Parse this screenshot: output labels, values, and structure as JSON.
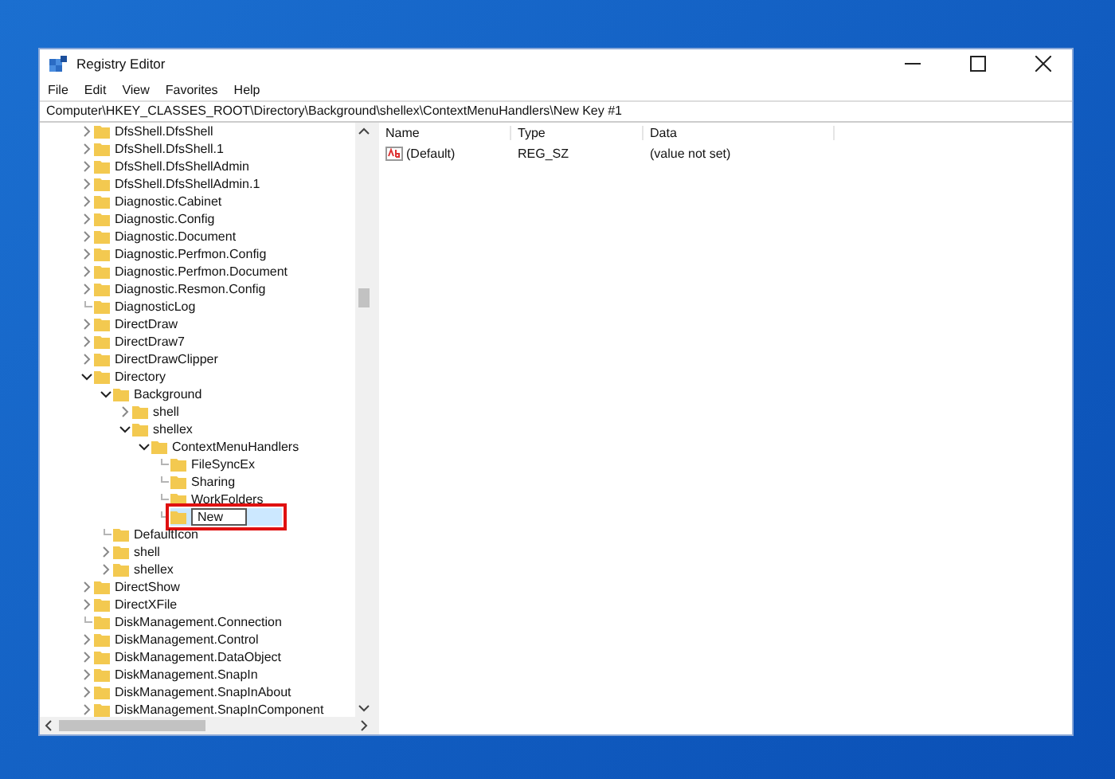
{
  "window": {
    "title": "Registry Editor"
  },
  "menu": [
    "File",
    "Edit",
    "View",
    "Favorites",
    "Help"
  ],
  "address": "Computer\\HKEY_CLASSES_ROOT\\Directory\\Background\\shellex\\ContextMenuHandlers\\New Key #1",
  "tree": [
    {
      "label": "DfsShell.DfsShell",
      "expandable": true,
      "expanded": false,
      "selected": false
    },
    {
      "label": "DfsShell.DfsShell.1",
      "expandable": true,
      "expanded": false,
      "selected": false
    },
    {
      "label": "DfsShell.DfsShellAdmin",
      "expandable": true,
      "expanded": false,
      "selected": false
    },
    {
      "label": "DfsShell.DfsShellAdmin.1",
      "expandable": true,
      "expanded": false,
      "selected": false
    },
    {
      "label": "Diagnostic.Cabinet",
      "expandable": true,
      "expanded": false,
      "selected": false
    },
    {
      "label": "Diagnostic.Config",
      "expandable": true,
      "expanded": false,
      "selected": false
    },
    {
      "label": "Diagnostic.Document",
      "expandable": true,
      "expanded": false,
      "selected": false
    },
    {
      "label": "Diagnostic.Perfmon.Config",
      "expandable": true,
      "expanded": false,
      "selected": false
    },
    {
      "label": "Diagnostic.Perfmon.Document",
      "expandable": true,
      "expanded": false,
      "selected": false
    },
    {
      "label": "Diagnostic.Resmon.Config",
      "expandable": true,
      "expanded": false,
      "selected": false
    },
    {
      "label": "DiagnosticLog",
      "expandable": false,
      "selected": false
    },
    {
      "label": "DirectDraw",
      "expandable": true,
      "expanded": false,
      "selected": false
    },
    {
      "label": "DirectDraw7",
      "expandable": true,
      "expanded": false,
      "selected": false
    },
    {
      "label": "DirectDrawClipper",
      "expandable": true,
      "expanded": false,
      "selected": false
    },
    {
      "label": "Directory",
      "expandable": true,
      "expanded": true,
      "selected": false,
      "children": [
        {
          "label": "Background",
          "expandable": true,
          "expanded": true,
          "selected": false,
          "children": [
            {
              "label": "shell",
              "expandable": true,
              "expanded": false,
              "selected": false
            },
            {
              "label": "shellex",
              "expandable": true,
              "expanded": true,
              "selected": false,
              "children": [
                {
                  "label": "ContextMenuHandlers",
                  "expandable": true,
                  "expanded": true,
                  "selected": false,
                  "children": [
                    {
                      "label": "FileSyncEx",
                      "expandable": false,
                      "selected": false
                    },
                    {
                      "label": "Sharing",
                      "expandable": false,
                      "selected": false
                    },
                    {
                      "label": "WorkFolders",
                      "expandable": false,
                      "selected": false
                    },
                    {
                      "label": "New",
                      "expandable": false,
                      "selected": true,
                      "editing": true,
                      "highlighted": true
                    }
                  ]
                }
              ]
            }
          ]
        },
        {
          "label": "DefaultIcon",
          "expandable": false,
          "selected": false
        },
        {
          "label": "shell",
          "expandable": true,
          "expanded": false,
          "selected": false
        },
        {
          "label": "shellex",
          "expandable": true,
          "expanded": false,
          "selected": false
        }
      ]
    },
    {
      "label": "DirectShow",
      "expandable": true,
      "expanded": false,
      "selected": false
    },
    {
      "label": "DirectXFile",
      "expandable": true,
      "expanded": false,
      "selected": false
    },
    {
      "label": "DiskManagement.Connection",
      "expandable": false,
      "selected": false
    },
    {
      "label": "DiskManagement.Control",
      "expandable": true,
      "expanded": false,
      "selected": false
    },
    {
      "label": "DiskManagement.DataObject",
      "expandable": true,
      "expanded": false,
      "selected": false
    },
    {
      "label": "DiskManagement.SnapIn",
      "expandable": true,
      "expanded": false,
      "selected": false
    },
    {
      "label": "DiskManagement.SnapInAbout",
      "expandable": true,
      "expanded": false,
      "selected": false
    },
    {
      "label": "DiskManagement.SnapInComponent",
      "expandable": true,
      "expanded": false,
      "selected": false
    }
  ],
  "values": {
    "columns": [
      "Name",
      "Type",
      "Data"
    ],
    "rows": [
      {
        "name": "(Default)",
        "type": "REG_SZ",
        "data": "(value not set)"
      }
    ]
  }
}
